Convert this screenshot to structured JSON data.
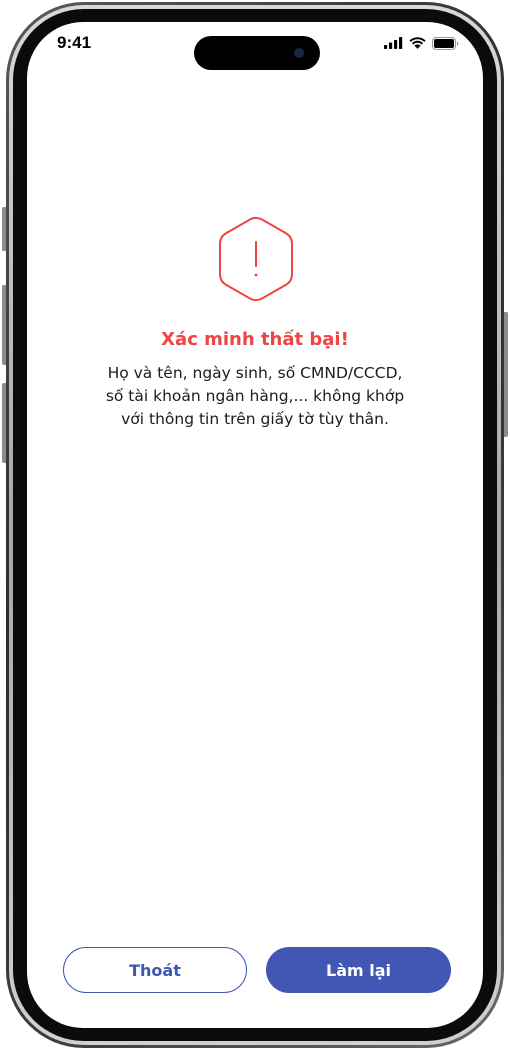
{
  "status_bar": {
    "time": "9:41",
    "icons": [
      "cellular-signal-icon",
      "wifi-icon",
      "battery-icon"
    ]
  },
  "alert": {
    "icon": "warning-hexagon-icon",
    "title": "Xác minh thất bại!",
    "message_lines": [
      "Họ và tên, ngày sinh, số CMND/CCCD,",
      "số tài khoản ngân hàng,... không khớp",
      "với thông tin trên giấy tờ tùy thân."
    ]
  },
  "actions": {
    "exit_label": "Thoát",
    "retry_label": "Làm lại"
  },
  "colors": {
    "error": "#ef4444",
    "primary": "#4256b3",
    "text": "#1c1c1c",
    "background": "#ffffff"
  }
}
